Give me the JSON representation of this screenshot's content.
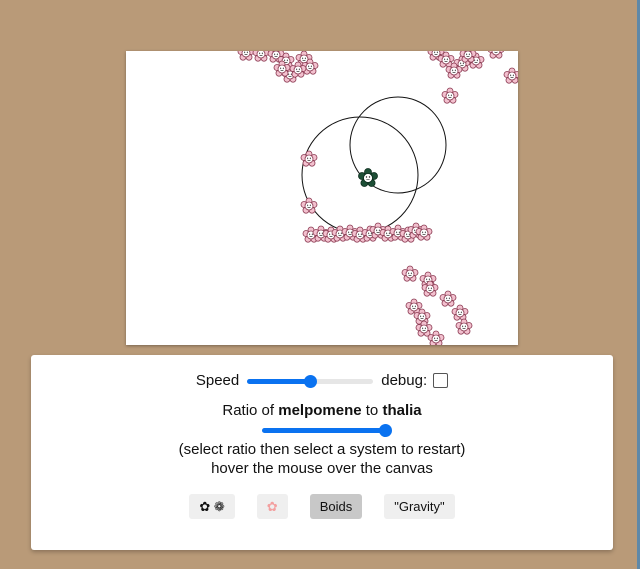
{
  "colors": {
    "background": "#b99a78",
    "accent": "#0a72f0",
    "flower": "#f3c1cf",
    "dark_flower": "#1d4f36"
  },
  "controls": {
    "speed_label": "Speed",
    "speed_value": 0.5,
    "debug_label": "debug:",
    "debug_checked": false,
    "ratio_prefix": "Ratio of",
    "ratio_a": "melpomene",
    "ratio_to": "to",
    "ratio_b": "thalia",
    "ratio_value": 1.0,
    "hint1": "(select ratio then select a system to restart)",
    "hint2": "hover the mouse over the canvas"
  },
  "buttons": [
    {
      "label": "✿ ❁",
      "active": false
    },
    {
      "label": "✿",
      "active": false
    },
    {
      "label": "Boids",
      "active": true
    },
    {
      "label": "\"Gravity\"",
      "active": false
    }
  ]
}
